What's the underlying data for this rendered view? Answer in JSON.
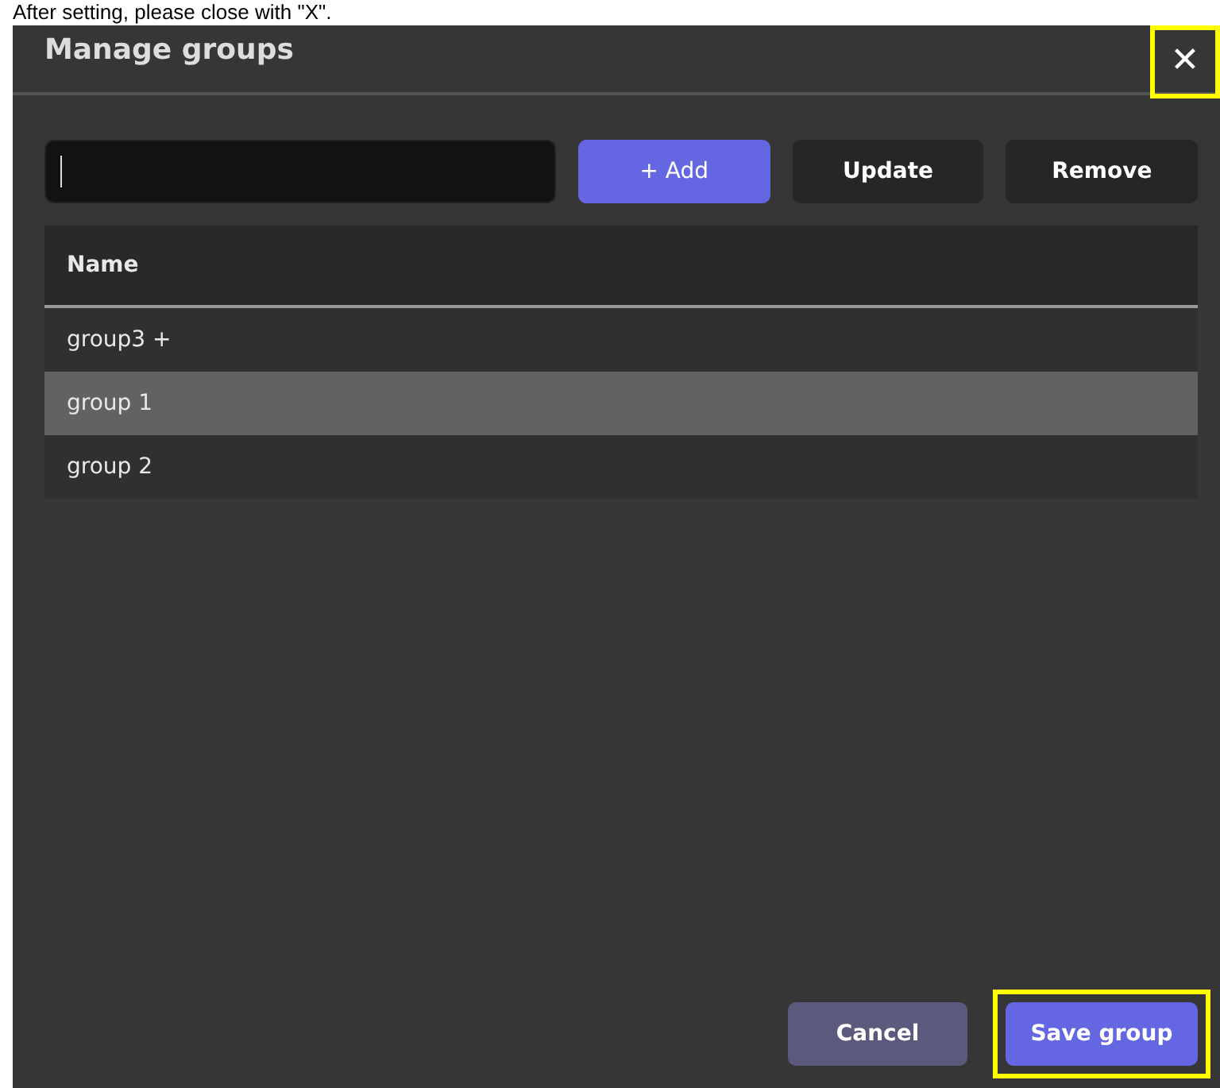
{
  "caption": "After setting, please close with \"X\".",
  "dialog": {
    "title": "Manage groups",
    "close": {
      "label": "✕",
      "highlighted": true
    }
  },
  "toolbar": {
    "input": {
      "focused": true
    },
    "buttons": [
      {
        "label": "+ Add",
        "kind": "primary"
      },
      {
        "label": "Update",
        "kind": "dark"
      },
      {
        "label": "Remove",
        "kind": "dark"
      }
    ]
  },
  "table": {
    "columns": [
      "Name"
    ],
    "rows": [
      {
        "name": "group3 +",
        "selected": false
      },
      {
        "name": "group 1",
        "selected": true
      },
      {
        "name": "group 2",
        "selected": false
      }
    ]
  },
  "footer": {
    "buttons": [
      {
        "label": "Cancel",
        "kind": "muted",
        "highlighted": false
      },
      {
        "label": "Save group",
        "kind": "primary",
        "highlighted": true
      }
    ]
  }
}
